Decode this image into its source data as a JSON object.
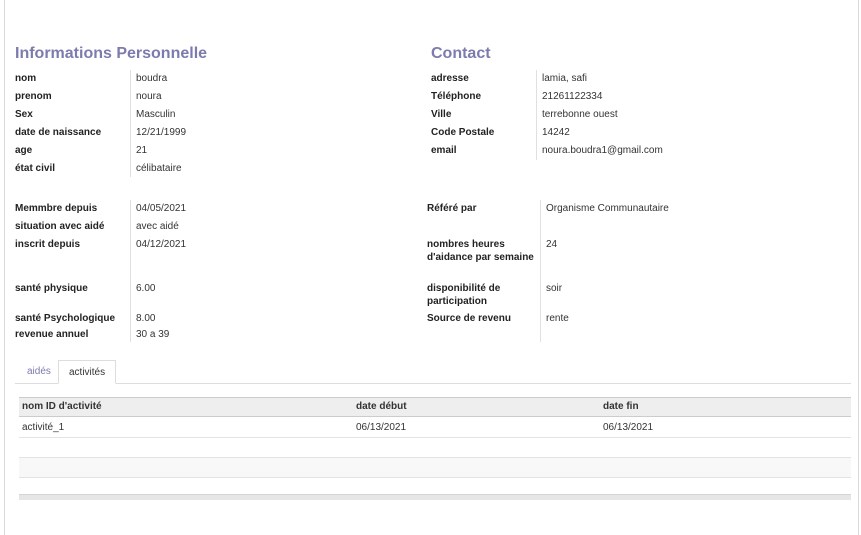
{
  "personal": {
    "title": "Informations Personnelle",
    "fields": [
      {
        "label": "nom",
        "value": "boudra"
      },
      {
        "label": "prenom",
        "value": "noura"
      },
      {
        "label": "Sex",
        "value": "Masculin"
      },
      {
        "label": "date de naissance",
        "value": "12/21/1999"
      },
      {
        "label": "age",
        "value": "21"
      },
      {
        "label": "état civil",
        "value": "célibataire"
      }
    ]
  },
  "contact": {
    "title": "Contact",
    "fields": [
      {
        "label": "adresse",
        "value": "lamia, safi"
      },
      {
        "label": "Téléphone",
        "value": "21261122334"
      },
      {
        "label": "Ville",
        "value": "terrebonne ouest"
      },
      {
        "label": "Code Postale",
        "value": "14242"
      },
      {
        "label": "email",
        "value": "noura.boudra1@gmail.com"
      }
    ]
  },
  "membership": {
    "left": [
      {
        "label": "Memmbre depuis",
        "value": "04/05/2021"
      },
      {
        "label": "situation avec aidé",
        "value": "avec aidé"
      },
      {
        "label": "inscrit depuis",
        "value": "04/12/2021"
      },
      {
        "label": "santé physique",
        "value": "6.00"
      },
      {
        "label": "santé Psychologique",
        "value": "8.00"
      },
      {
        "label": "revenue annuel",
        "value": "30 a 39"
      }
    ],
    "right": [
      {
        "label": "Référé par",
        "value": "Organisme Communautaire"
      },
      {
        "label": "nombres heures d'aidance par semaine",
        "value": "24"
      },
      {
        "label": "disponibilité de participation",
        "value": "soir"
      },
      {
        "label": "Source de revenu",
        "value": "rente"
      }
    ]
  },
  "tabs": [
    {
      "label": "aidés",
      "active": false
    },
    {
      "label": "activités",
      "active": true
    }
  ],
  "table": {
    "columns": [
      "nom ID d'activité",
      "date début",
      "date fin"
    ],
    "rows": [
      [
        "activité_1",
        "06/13/2021",
        "06/13/2021"
      ]
    ]
  },
  "colors": {
    "accent": "#7c7bad",
    "header_bg": "#eeeeee"
  }
}
